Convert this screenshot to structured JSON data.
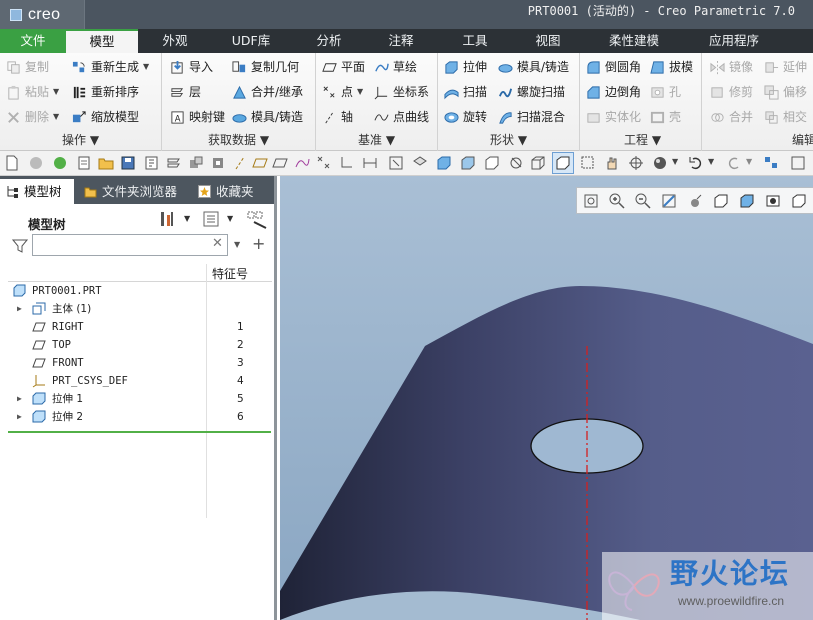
{
  "app": {
    "brand": "creo",
    "window_title": "PRT0001 (活动的) - Creo Parametric 7.0"
  },
  "menu": {
    "tabs": [
      "文件",
      "模型",
      "外观",
      "UDF库",
      "分析",
      "注释",
      "工具",
      "视图",
      "柔性建模",
      "应用程序"
    ]
  },
  "ribbon": {
    "groups": [
      {
        "label": "操作",
        "items": [
          "复制",
          "粘贴",
          "删除",
          "重新生成",
          "重新排序",
          "缩放模型"
        ]
      },
      {
        "label": "获取数据",
        "items": [
          "导入",
          "层",
          "映射键",
          "复制几何",
          "合并/继承",
          "模具/铸造"
        ]
      },
      {
        "label": "基准",
        "items": [
          "平面",
          "点",
          "轴",
          "草绘",
          "坐标系",
          "点曲线"
        ]
      },
      {
        "label": "形状",
        "items": [
          "拉伸",
          "扫描",
          "旋转",
          "模具/铸造",
          "螺旋扫描",
          "扫描混合"
        ]
      },
      {
        "label": "工程",
        "items": [
          "倒圆角",
          "边倒角",
          "实体化",
          "拔模",
          "孔",
          "壳"
        ]
      },
      {
        "label": "编辑",
        "items": [
          "镜像",
          "修剪",
          "合并",
          "延伸",
          "偏移",
          "相交"
        ]
      }
    ]
  },
  "panel": {
    "tabs": [
      "模型树",
      "文件夹浏览器",
      "收藏夹"
    ],
    "tree_title": "模型树",
    "filter_placeholder": "",
    "col_feature_number": "特征号",
    "rows": [
      {
        "label": "PRT0001.PRT",
        "num": ""
      },
      {
        "label": "主体 (1)",
        "num": ""
      },
      {
        "label": "RIGHT",
        "num": "1"
      },
      {
        "label": "TOP",
        "num": "2"
      },
      {
        "label": "FRONT",
        "num": "3"
      },
      {
        "label": "PRT_CSYS_DEF",
        "num": "4"
      },
      {
        "label": "拉伸 1",
        "num": "5"
      },
      {
        "label": "拉伸 2",
        "num": "6"
      }
    ]
  },
  "watermark": {
    "title": "野火论坛",
    "url": "www.proewildfire.cn"
  },
  "colors": {
    "file_tab": "#3aa043",
    "part_surface": "#4d5680",
    "background": "#a6bcd2"
  }
}
